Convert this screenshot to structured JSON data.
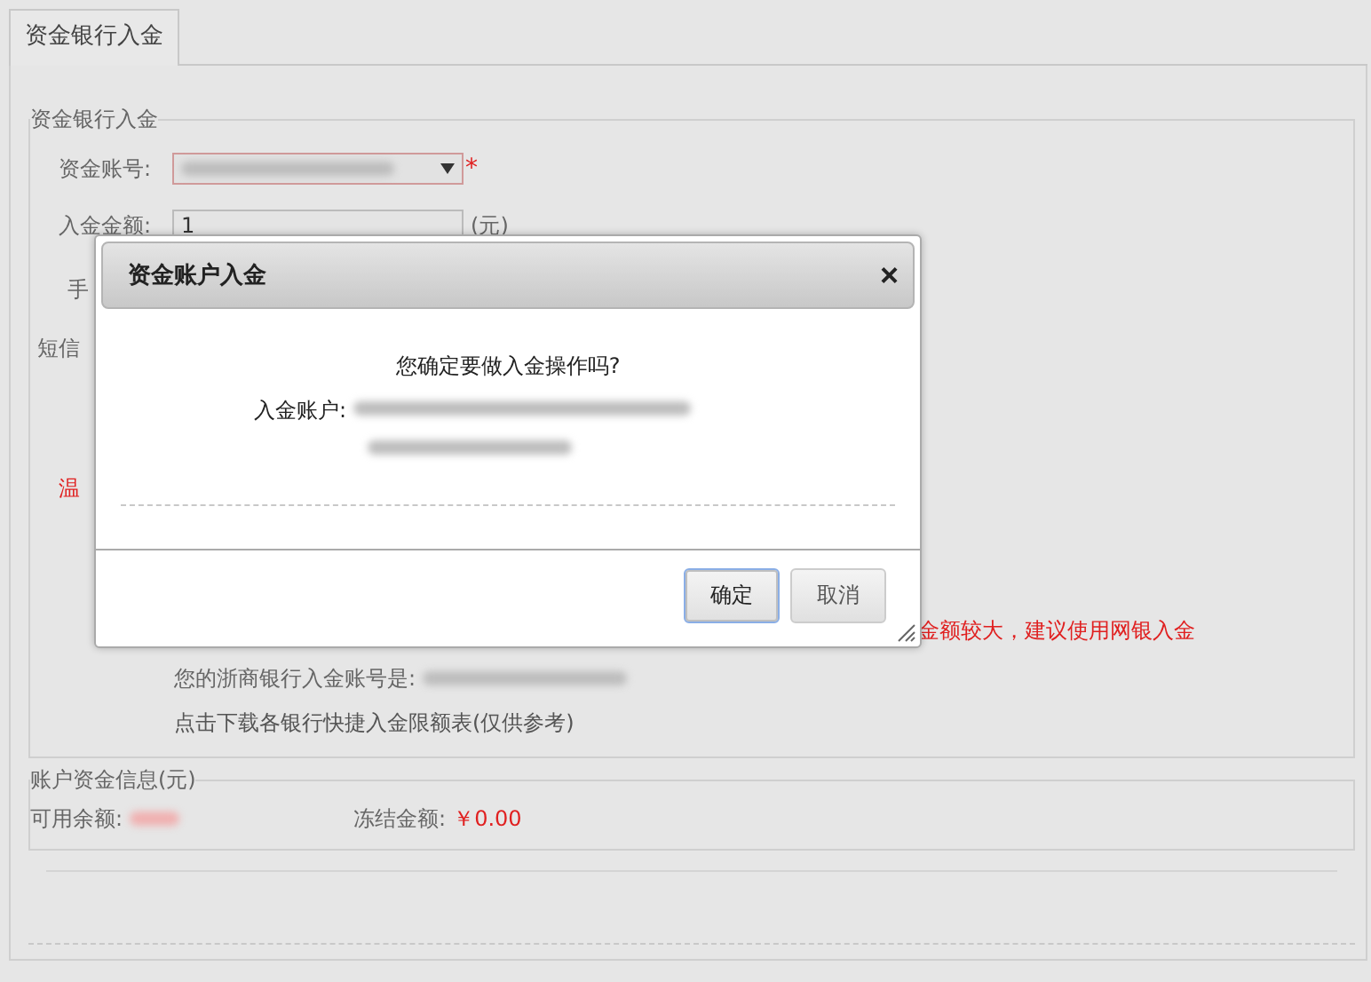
{
  "tabs": [
    {
      "label": "资金银行入金",
      "selected": true
    }
  ],
  "form": {
    "legend": "资金银行入金",
    "account_label": "资金账号:",
    "required_mark": "*",
    "amount_label": "入金金额:",
    "amount_value": "1",
    "amount_unit": "(元)",
    "label_3": "手",
    "label_4": "短信",
    "label_5": "温",
    "warning": "金额较大，建议使用网银入金",
    "bank_account_label": "您的浙商银行入金账号是:",
    "download_link": "点击下载各银行快捷入金限额表(仅供参考)"
  },
  "funds": {
    "legend": "账户资金信息(元)",
    "available_label": "可用余额:",
    "frozen_label": "冻结金额:",
    "frozen_value": "￥0.00"
  },
  "dialog": {
    "title": "资金账户入金",
    "close": "×",
    "question": "您确定要做入金操作吗?",
    "account_label": "入金账户:",
    "buttons": [
      {
        "label": "确定",
        "selected": true
      },
      {
        "label": "取消",
        "selected": false
      }
    ]
  }
}
